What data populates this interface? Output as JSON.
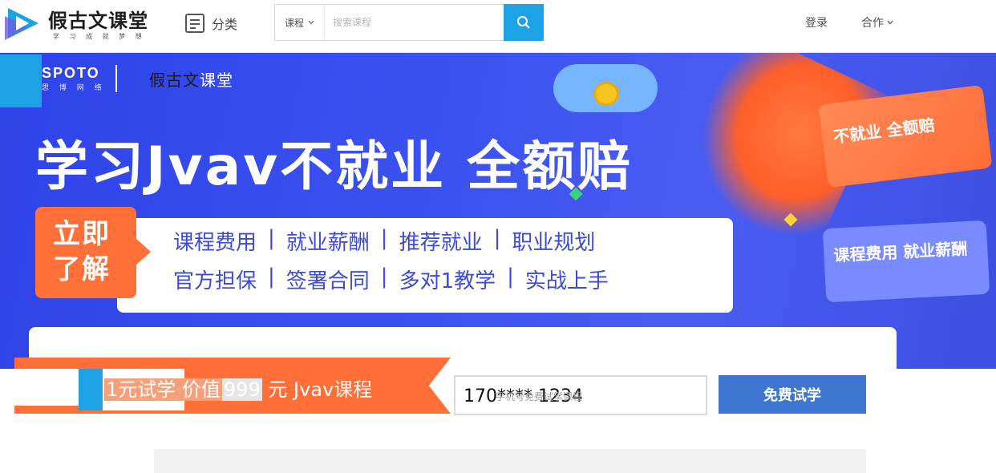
{
  "header": {
    "logo_name": "假古文课堂",
    "logo_slogan": "学 习 成 就 梦 想",
    "category_label": "分类",
    "search": {
      "type_label": "课程",
      "placeholder": "搜索课程"
    },
    "login_label": "登录",
    "cooperate_label": "合作"
  },
  "banner": {
    "spoto_en": "SPOTO",
    "spoto_cn": "思 博 网 络",
    "brand_prefix": "假古文",
    "brand_suffix": "课堂",
    "headline": "学习Jvav不就业 全额赔",
    "learn_badge_line1": "立即",
    "learn_badge_line2": "了解",
    "tags_row1": [
      "课程费用",
      "就业薪酬",
      "推荐就业",
      "职业规划"
    ],
    "tags_row2": [
      "官方担保",
      "签署合同",
      "多对1教学",
      "实战上手"
    ],
    "side_tag_top": "不就业 全额赔",
    "side_tag_bottom": "课程费用 就业薪酬"
  },
  "trial": {
    "text_a": "1元试学 价值",
    "text_price": "999",
    "text_b": "元 Jvav课程",
    "phone_value": "170**** 1234",
    "phone_hint": "手机号免费试学课程",
    "button_label": "免费试学"
  },
  "colors": {
    "accent_blue": "#1ea2e6",
    "banner_blue": "#3b52f0",
    "orange": "#ff6f37",
    "button_blue": "#3f76d2"
  }
}
